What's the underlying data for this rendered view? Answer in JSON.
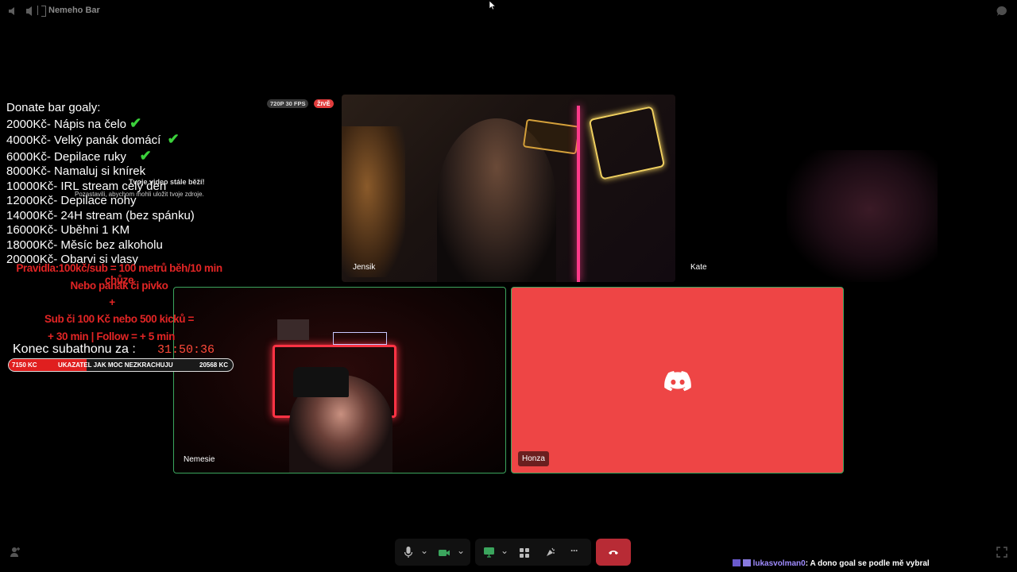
{
  "window": {
    "channel_name": "Nemeho Bar"
  },
  "stream_badges": {
    "quality": "720P 30 FPS",
    "live": "ŽIVĚ"
  },
  "overlay_toast": {
    "title": "Tvoje video stále běží!",
    "body": "Pozastavili, abychom mohli uložit tvoje zdroje."
  },
  "participants": {
    "jensik": {
      "name": "Jensik"
    },
    "kate": {
      "name": "Kate"
    },
    "nemesie": {
      "name": "Nemesie"
    },
    "honza": {
      "name": "Honza"
    }
  },
  "donate": {
    "header": "Donate bar goaly:",
    "goals": [
      {
        "amount": "2000Kč",
        "text": "- Nápis na čelo",
        "done": true
      },
      {
        "amount": "4000Kč",
        "text": "- Velký panák domácí",
        "done": true
      },
      {
        "amount": "6000Kč",
        "text": "- Depilace ruky",
        "done": true
      },
      {
        "amount": "8000Kč",
        "text": "- Namaluj si knírek",
        "done": false
      },
      {
        "amount": "10000Kč",
        "text": "- IRL stream celý den",
        "done": false
      },
      {
        "amount": "12000Kč",
        "text": "- Depilace nohy",
        "done": false
      },
      {
        "amount": "14000Kč",
        "text": "- 24H stream (bez spánku)",
        "done": false
      },
      {
        "amount": "16000Kč",
        "text": "-   Uběhni 1 KM",
        "done": false
      },
      {
        "amount": "18000Kč",
        "text": "- Měsíc bez alkoholu",
        "done": false
      },
      {
        "amount": "20000Kč",
        "text": "- Obarvi si vlasy",
        "done": false
      }
    ],
    "check_glyph": "✔",
    "rules": [
      "Pravidla:100kč/sub = 100 metrů běh/10 min chůze",
      "Nebo panák či pivko",
      "+",
      "Sub či 100 Kč nebo 500 kicků =",
      "+ 30 min | Follow = + 5 min"
    ],
    "timer_label": "Konec subathonu za :",
    "timer_value": "31:50:36",
    "bar_current": "7150 KC",
    "bar_title": "UKAZATEL JAK MOC NEZKRACHUJU",
    "bar_goal": "20568 KC",
    "bar_fraction": 0.348
  },
  "toolbar": {
    "mic_icon": "🎤",
    "camera_icon": "📹",
    "screen_icon": "🖥",
    "activities_icon": "⚃",
    "soundboard_icon": "✺",
    "more_icon": "···",
    "leave_icon": "☎",
    "chevron": "⌄"
  },
  "chat": {
    "user": "lukasvolman0",
    "message": ": A dono goal se podle mě vybral"
  },
  "colors": {
    "accent_red": "#f04747",
    "discord_red_tile": "#ee4545",
    "speaking_green": "#3ba55d",
    "leave_red": "#b82b35"
  }
}
